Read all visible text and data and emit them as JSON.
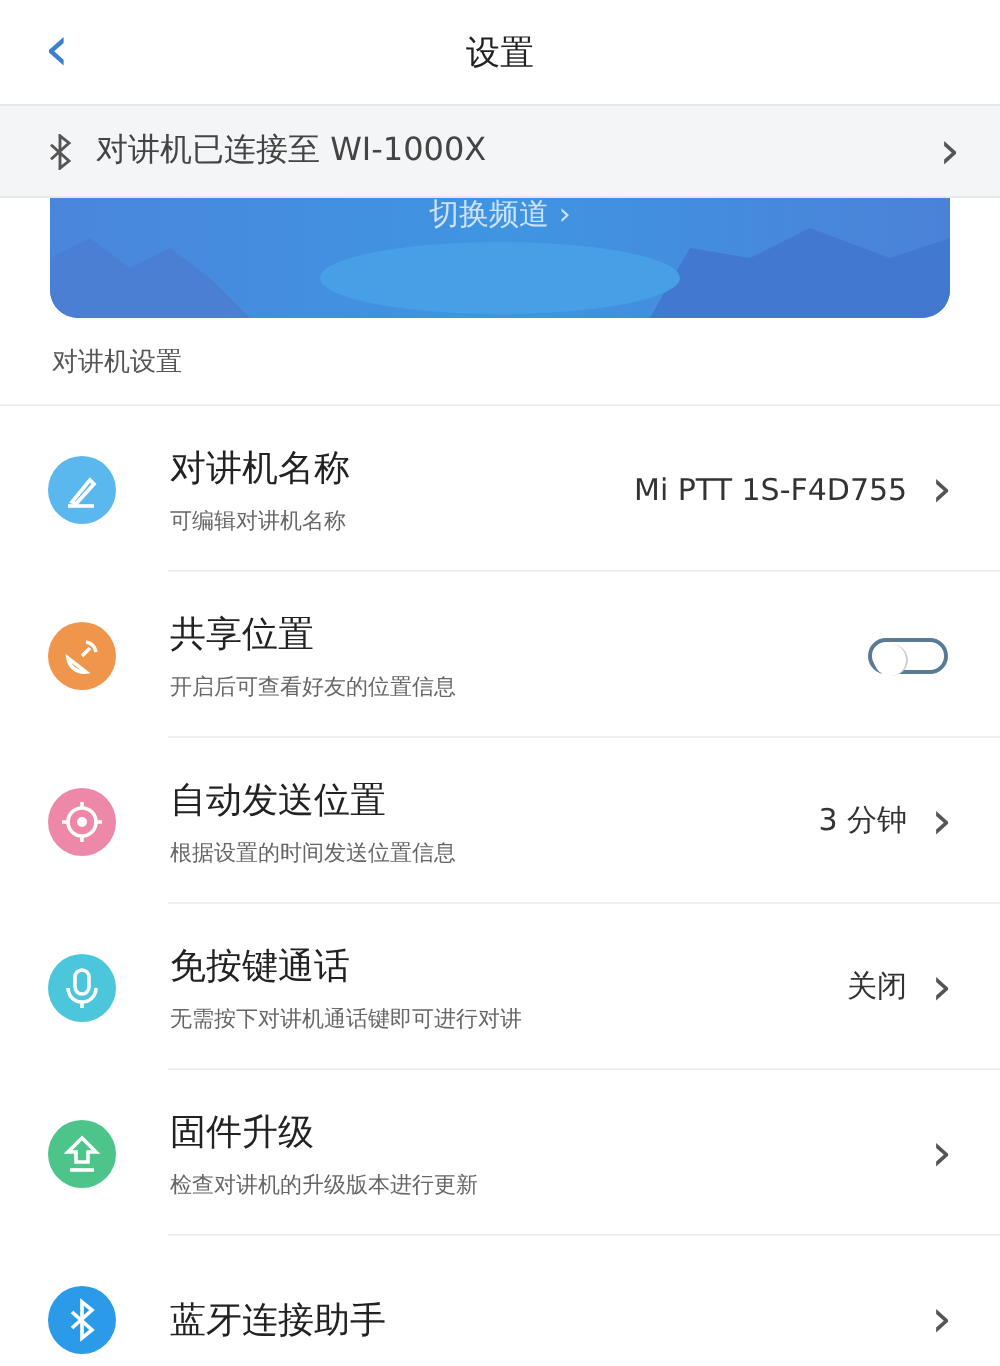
{
  "header": {
    "back": "‹",
    "title": "设置"
  },
  "connection_banner": {
    "text": "对讲机已连接至 WI-1000X",
    "chevron": "›"
  },
  "channel_card": {
    "label": "切换频道 ›"
  },
  "section_title": "对讲机设置",
  "rows": [
    {
      "kind": "value",
      "color": "#5bb8ee",
      "title": "对讲机名称",
      "subtitle": "可编辑对讲机名称",
      "value": "Mi PTT 1S-F4D755",
      "chevron": "›"
    },
    {
      "kind": "toggle",
      "color": "#f0964c",
      "title": "共享位置",
      "subtitle": "开启后可查看好友的位置信息",
      "on": false
    },
    {
      "kind": "value",
      "color": "#ee88a8",
      "title": "自动发送位置",
      "subtitle": "根据设置的时间发送位置信息",
      "value": "3 分钟",
      "chevron": "›"
    },
    {
      "kind": "value",
      "color": "#4cc6da",
      "title": "免按键通话",
      "subtitle": "无需按下对讲机通话键即可进行对讲",
      "value": "关闭",
      "chevron": "›"
    },
    {
      "kind": "chevron",
      "color": "#4cc48a",
      "title": "固件升级",
      "subtitle": "检查对讲机的升级版本进行更新",
      "chevron": "›"
    },
    {
      "kind": "chevron",
      "color": "#2b9ae8",
      "title": "蓝牙连接助手",
      "chevron": "›"
    }
  ]
}
